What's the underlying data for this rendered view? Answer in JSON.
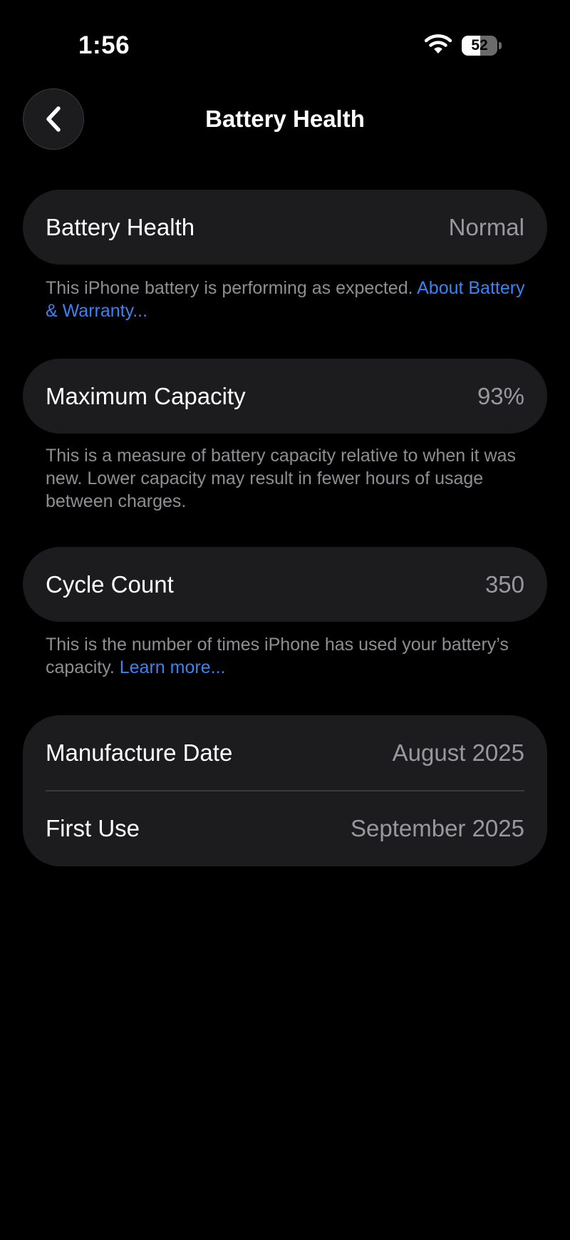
{
  "status_bar": {
    "time": "1:56",
    "battery_level": "52",
    "battery_fraction": 0.52
  },
  "header": {
    "title": "Battery Health"
  },
  "sections": {
    "health": {
      "label": "Battery Health",
      "value": "Normal",
      "footnote_text": "This iPhone battery is performing as expected. ",
      "footnote_link": "About Battery & Warranty..."
    },
    "capacity": {
      "label": "Maximum Capacity",
      "value": "93%",
      "footnote_text": "This is a measure of battery capacity relative to when it was new. Lower capacity may result in fewer hours of usage between charges."
    },
    "cycles": {
      "label": "Cycle Count",
      "value": "350",
      "footnote_text": "This is the number of times iPhone has used your battery’s capacity. ",
      "footnote_link": "Learn more..."
    },
    "dates": {
      "manufacture_label": "Manufacture Date",
      "manufacture_value": "August 2025",
      "first_use_label": "First Use",
      "first_use_value": "September 2025"
    }
  },
  "icons": {
    "back": "chevron-left-icon",
    "wifi": "wifi-icon",
    "battery": "battery-icon"
  },
  "colors": {
    "background": "#000000",
    "card": "#1c1c1e",
    "secondary_text": "#98989e",
    "footnote_text": "#8e8e93",
    "link": "#3b82f6"
  }
}
